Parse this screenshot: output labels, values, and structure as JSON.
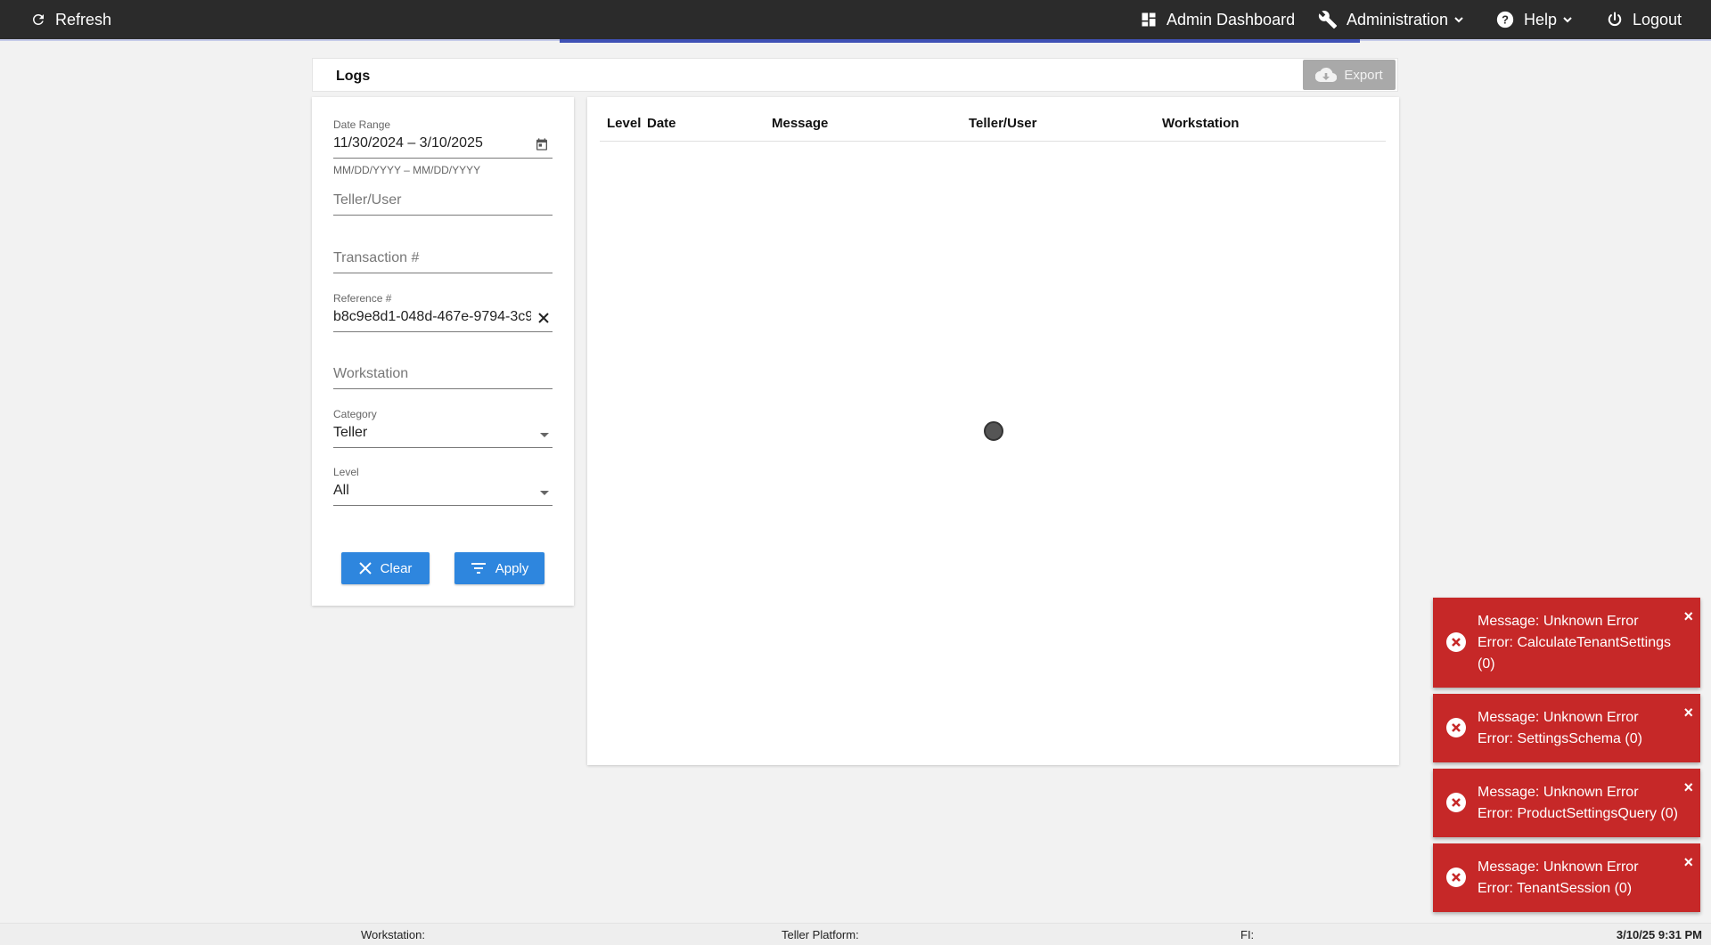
{
  "topbar": {
    "refresh_label": "Refresh",
    "admin_dashboard_label": "Admin Dashboard",
    "administration_label": "Administration",
    "help_label": "Help",
    "logout_label": "Logout",
    "progress_color": "#3f51b5"
  },
  "logs": {
    "title": "Logs",
    "export_label": "Export"
  },
  "filters": {
    "date_range": {
      "label": "Date Range",
      "value": "11/30/2024 – 3/10/2025",
      "hint": "MM/DD/YYYY – MM/DD/YYYY"
    },
    "teller_user": {
      "placeholder": "Teller/User"
    },
    "transaction": {
      "placeholder": "Transaction #"
    },
    "reference": {
      "label": "Reference #",
      "value": "b8c9e8d1-048d-467e-9794-3c9"
    },
    "workstation": {
      "placeholder": "Workstation"
    },
    "category": {
      "label": "Category",
      "value": "Teller"
    },
    "level": {
      "label": "Level",
      "value": "All"
    },
    "clear_label": "Clear",
    "apply_label": "Apply",
    "button_color": "#2e86de"
  },
  "table": {
    "columns": [
      "Level",
      "Date",
      "Message",
      "Teller/User",
      "Workstation"
    ]
  },
  "toasts": [
    {
      "line1": "Message: Unknown Error",
      "line2": "Error: CalculateTenantSettings (0)"
    },
    {
      "line1": "Message: Unknown Error",
      "line2": "Error: SettingsSchema (0)"
    },
    {
      "line1": "Message: Unknown Error",
      "line2": "Error: ProductSettingsQuery (0)"
    },
    {
      "line1": "Message: Unknown Error",
      "line2": "Error: TenantSession (0)"
    }
  ],
  "toast_color": "#c62828",
  "statusbar": {
    "workstation_label": "Workstation:",
    "teller_platform_label": "Teller Platform:",
    "fi_label": "FI:",
    "datetime": "3/10/25 9:31 PM"
  }
}
